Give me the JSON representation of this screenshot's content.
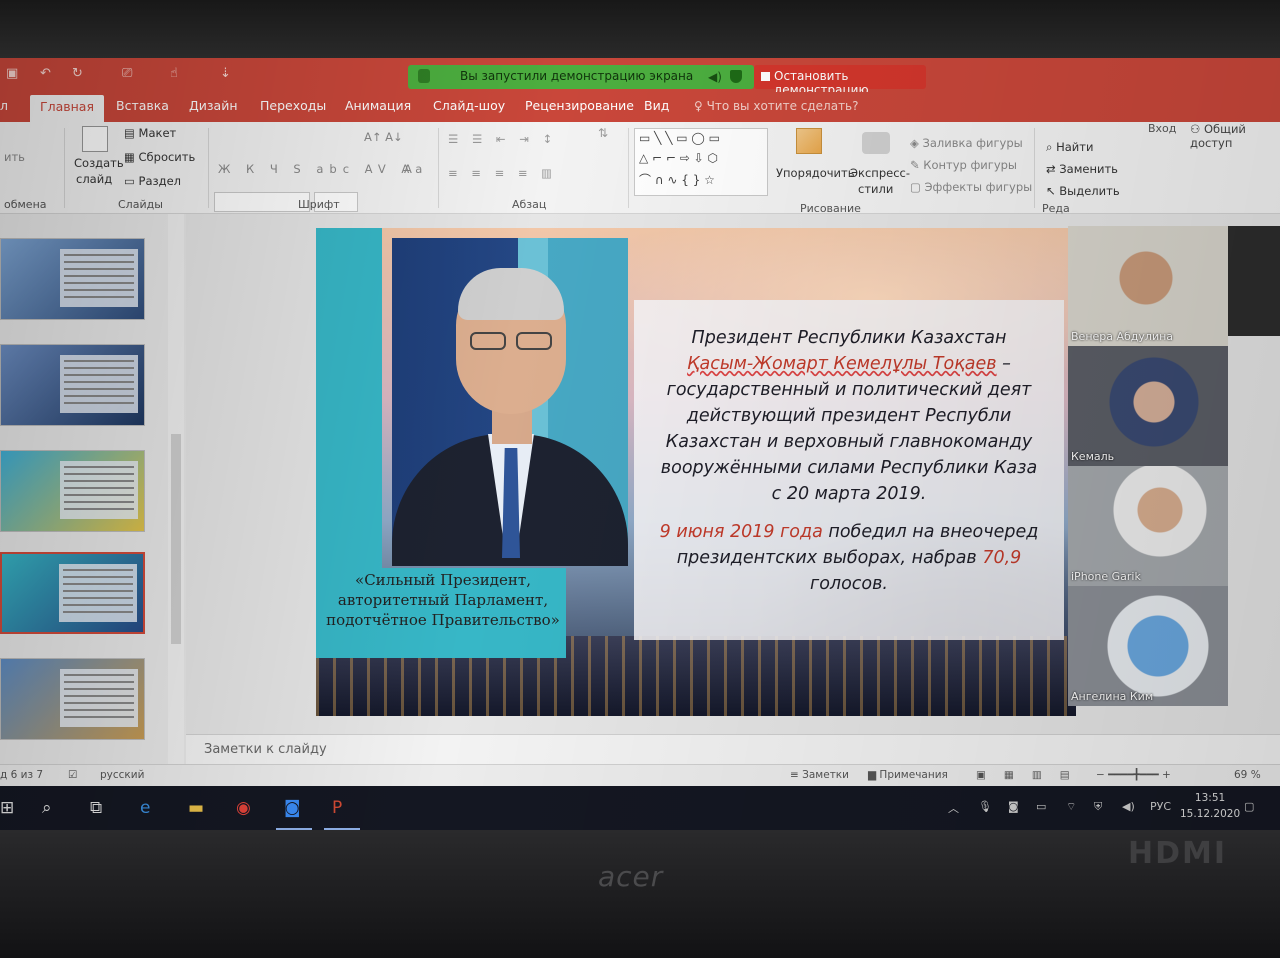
{
  "titlebar": {
    "share_text": "Вы запустили демонстрацию экрана",
    "stop_label": "Остановить демонстрацию"
  },
  "tabs": [
    "Главная",
    "Вставка",
    "Дизайн",
    "Переходы",
    "Анимация",
    "Слайд-шоу",
    "Рецензирование",
    "Вид"
  ],
  "tab_first_partial": "л",
  "tell_me": "Что вы хотите сделать?",
  "account": {
    "login": "Вход",
    "share": "Общий доступ"
  },
  "ribbon": {
    "clipboard_label": "обмена",
    "slides": {
      "create": "Создать",
      "slide": "слайд",
      "layout": "Макет",
      "reset": "Сбросить",
      "section": "Раздел",
      "label": "Слайды"
    },
    "font_label": "Шрифт",
    "paragraph_label": "Абзац",
    "drawing": {
      "arrange": "Упорядочить",
      "quick_styles": "Экспресс-",
      "quick_styles2": "стили",
      "fill": "Заливка фигуры",
      "outline": "Контур фигуры",
      "effects": "Эффекты фигуры",
      "label": "Рисование"
    },
    "editing": {
      "find": "Найти",
      "replace": "Заменить",
      "select": "Выделить",
      "label": "Реда"
    }
  },
  "slide": {
    "quote": "«Сильный Президент, авторитетный Парламент, подотчётное Правительство»",
    "line1": "Президент Республики Казахстан",
    "name": "Қасым-Жомарт Кемелұлы Тоқаев",
    "line2_tail": " –",
    "line3": "государственный и политический деят",
    "line4": "действующий президент Республи",
    "line5": "Казахстан и верховный главнокоманду",
    "line6": "вооружёнными силами Республики Каза",
    "line7": "с 20 марта 2019.",
    "date": "9 июня 2019 года",
    "line8_tail": " победил на внеочеред",
    "line9": "президентских выборах, набрав ",
    "percent": "70,9",
    "line10": "голосов."
  },
  "notes_placeholder": "Заметки к слайду",
  "status": {
    "slide_counter": "д 6 из 7",
    "language": "русский",
    "notes": "Заметки",
    "comments": "Примечания",
    "zoom": "69 %"
  },
  "participants": [
    "Венера Абдулина",
    "Кемаль",
    "iPhone Garik",
    "Ангелина Ким"
  ],
  "taskbar": {
    "lang": "РУС",
    "time": "13:51",
    "date": "15.12.2020"
  },
  "bezel": {
    "brand": "acer",
    "port": "HDMI"
  },
  "colors": {
    "accent": "#c9473a",
    "share_green": "#4cae3f",
    "stop_red": "#d3362c",
    "teal": "#37b7c7"
  }
}
